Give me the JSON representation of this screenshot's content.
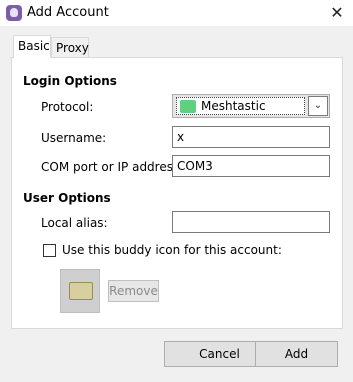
{
  "window": {
    "title": "Add Account",
    "close_glyph": "✕"
  },
  "tabs": [
    {
      "label": "Basic"
    },
    {
      "label": "Proxy"
    }
  ],
  "login_options": {
    "heading": "Login Options",
    "protocol_label": "Protocol:",
    "protocol_value": "Meshtastic",
    "protocol_icon": "meshtastic-icon",
    "username_label": "Username:",
    "username_value": "x",
    "com_label": "COM port or IP address:",
    "com_value": "COM3"
  },
  "user_options": {
    "heading": "User Options",
    "alias_label": "Local alias:",
    "alias_value": "",
    "buddy_icon_checkbox_label": "Use this buddy icon for this account:",
    "buddy_icon_checked": false,
    "remove_label": "Remove"
  },
  "buttons": {
    "cancel": "Cancel",
    "add": "Add"
  },
  "colors": {
    "protocol_icon": "#5ed080",
    "app_icon": "#7b5ea7"
  }
}
